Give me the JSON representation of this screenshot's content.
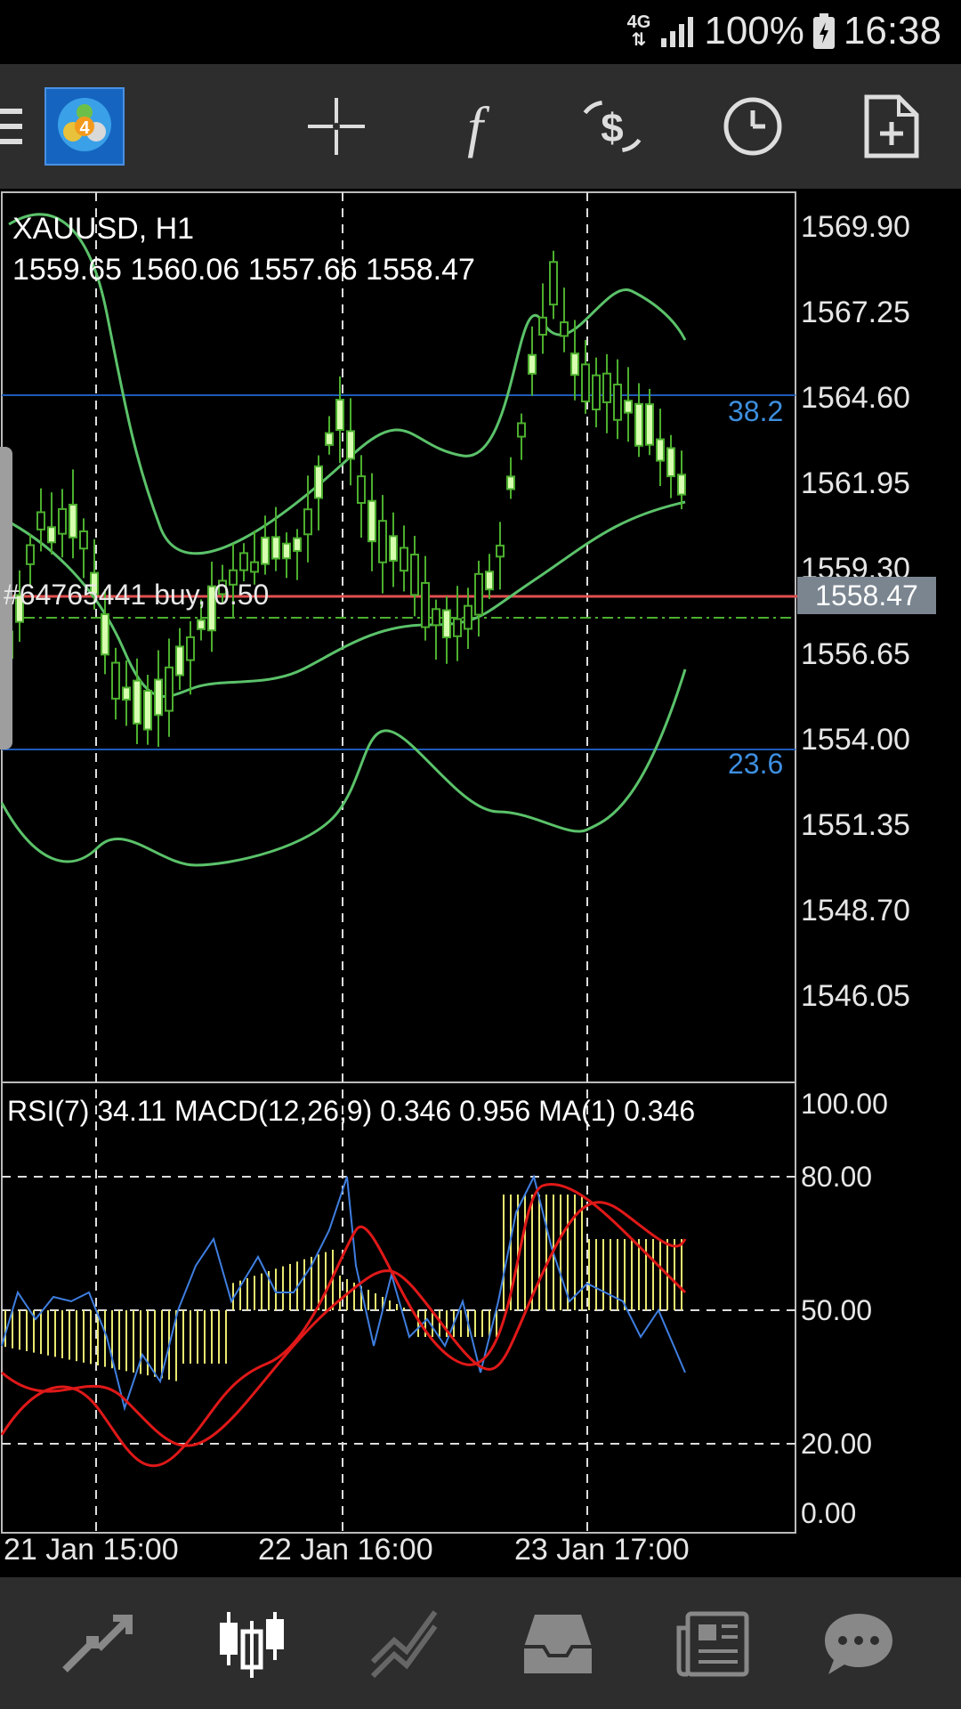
{
  "status": {
    "network": "4G",
    "battery": "100%",
    "time": "16:38"
  },
  "toolbar": {
    "menu_icon": "hamburger-icon",
    "logo_icon": "metatrader-logo",
    "crosshair_icon": "crosshair-icon",
    "indicators_icon": "function-icon",
    "trade_icon": "dollar-arrows-icon",
    "timeframe_icon": "clock-icon",
    "new_order_icon": "new-document-icon"
  },
  "chart": {
    "symbol": "XAUUSD, H1",
    "ohlc": "1559.65 1560.06 1557.66 1558.47",
    "order_line": "#64765441 buy, 0.50",
    "current_price": "1558.47",
    "fibo_upper": "38.2",
    "fibo_lower": "23.6",
    "price_axis": [
      "1569.90",
      "1567.25",
      "1564.60",
      "1561.95",
      "1559.30",
      "1556.65",
      "1554.00",
      "1551.35",
      "1548.70",
      "1546.05"
    ],
    "indicator_header": "RSI(7) 34.11 MACD(12,26,9) 0.346 0.956 MA(1) 0.346",
    "indicator_axis": [
      "100.00",
      "80.00",
      "50.00",
      "20.00",
      "0.00"
    ],
    "time_axis": [
      "21 Jan 15:00",
      "22 Jan 16:00",
      "23 Jan 17:00"
    ],
    "colors": {
      "candle": "#4caf2e",
      "bollinger": "#5bc26a",
      "fibo": "#1e5bb8",
      "order": "#e05050",
      "rsi": "#3f7ee0",
      "macd_signal": "#e01818",
      "macd_hist": "#e8e870"
    }
  },
  "bottom_nav": {
    "quotes_icon": "arrows-icon",
    "chart_icon": "candlestick-icon",
    "trade_icon": "trend-icon",
    "history_icon": "inbox-icon",
    "news_icon": "newspaper-icon",
    "messages_icon": "chat-icon"
  }
}
